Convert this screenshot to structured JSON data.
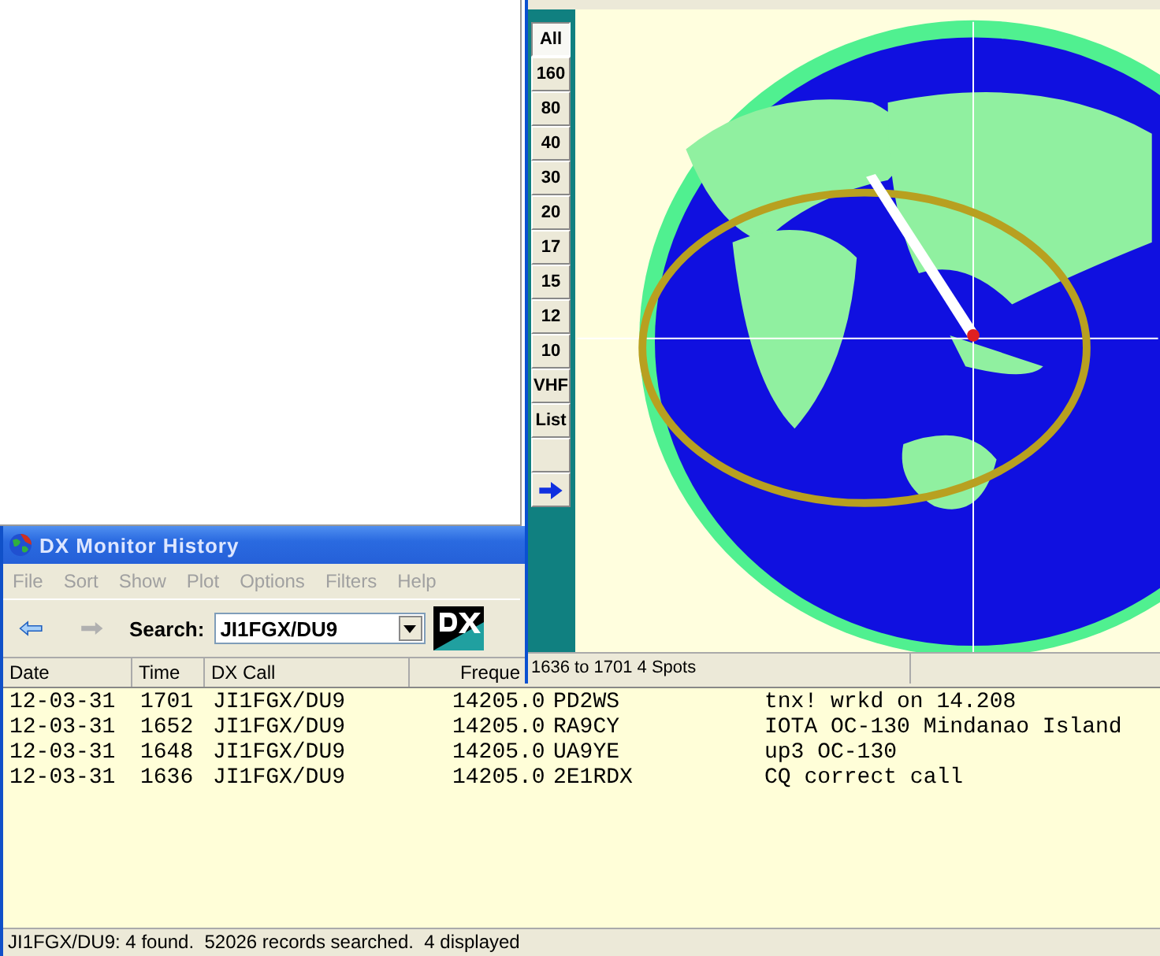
{
  "map_window": {
    "band_buttons": [
      {
        "label": "All",
        "selected": true
      },
      {
        "label": "160",
        "selected": false
      },
      {
        "label": "80",
        "selected": false
      },
      {
        "label": "40",
        "selected": false
      },
      {
        "label": "30",
        "selected": false
      },
      {
        "label": "20",
        "selected": false
      },
      {
        "label": "17",
        "selected": false
      },
      {
        "label": "15",
        "selected": false
      },
      {
        "label": "12",
        "selected": false
      },
      {
        "label": "10",
        "selected": false
      },
      {
        "label": "VHF",
        "selected": false
      },
      {
        "label": "List",
        "selected": false
      }
    ],
    "status": "1636 to 1701 4 Spots"
  },
  "history_window": {
    "title": "DX Monitor History",
    "menu": [
      "File",
      "Sort",
      "Show",
      "Plot",
      "Options",
      "Filters",
      "Help"
    ],
    "search": {
      "label": "Search:",
      "value": "JI1FGX/DU9"
    },
    "columns": [
      "Date",
      "Time",
      "DX Call",
      "Freque"
    ],
    "rows": [
      {
        "date": "12-03-31",
        "time": "1701",
        "call": "JI1FGX/DU9",
        "freq": "14205.0",
        "spotter": "PD2WS",
        "comment": "tnx! wrkd on 14.208"
      },
      {
        "date": "12-03-31",
        "time": "1652",
        "call": "JI1FGX/DU9",
        "freq": "14205.0",
        "spotter": "RA9CY",
        "comment": "IOTA OC-130 Mindanao Island"
      },
      {
        "date": "12-03-31",
        "time": "1648",
        "call": "JI1FGX/DU9",
        "freq": "14205.0",
        "spotter": "UA9YE",
        "comment": "up3 OC-130"
      },
      {
        "date": "12-03-31",
        "time": "1636",
        "call": "JI1FGX/DU9",
        "freq": "14205.0",
        "spotter": "2E1RDX",
        "comment": "CQ correct call"
      }
    ],
    "status_bar": "JI1FGX/DU9: 4 found.  52026 records searched.  4 displayed"
  }
}
